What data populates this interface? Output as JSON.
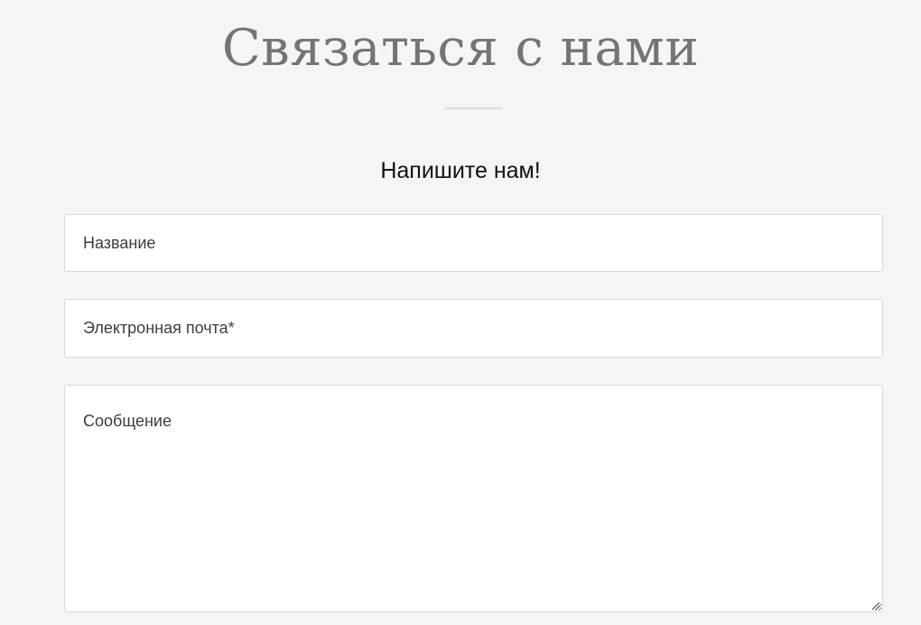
{
  "page": {
    "title": "Связаться с нами",
    "subtitle": "Напишите нам!"
  },
  "form": {
    "name_placeholder": "Название",
    "email_placeholder": "Электронная почта*",
    "message_placeholder": "Сообщение"
  },
  "colors": {
    "background": "#f5f5f5",
    "title": "#747474",
    "field_background": "#ffffff",
    "field_border": "#d9d9d9"
  },
  "icons": {
    "resize_handle": "resize-grip-icon"
  }
}
